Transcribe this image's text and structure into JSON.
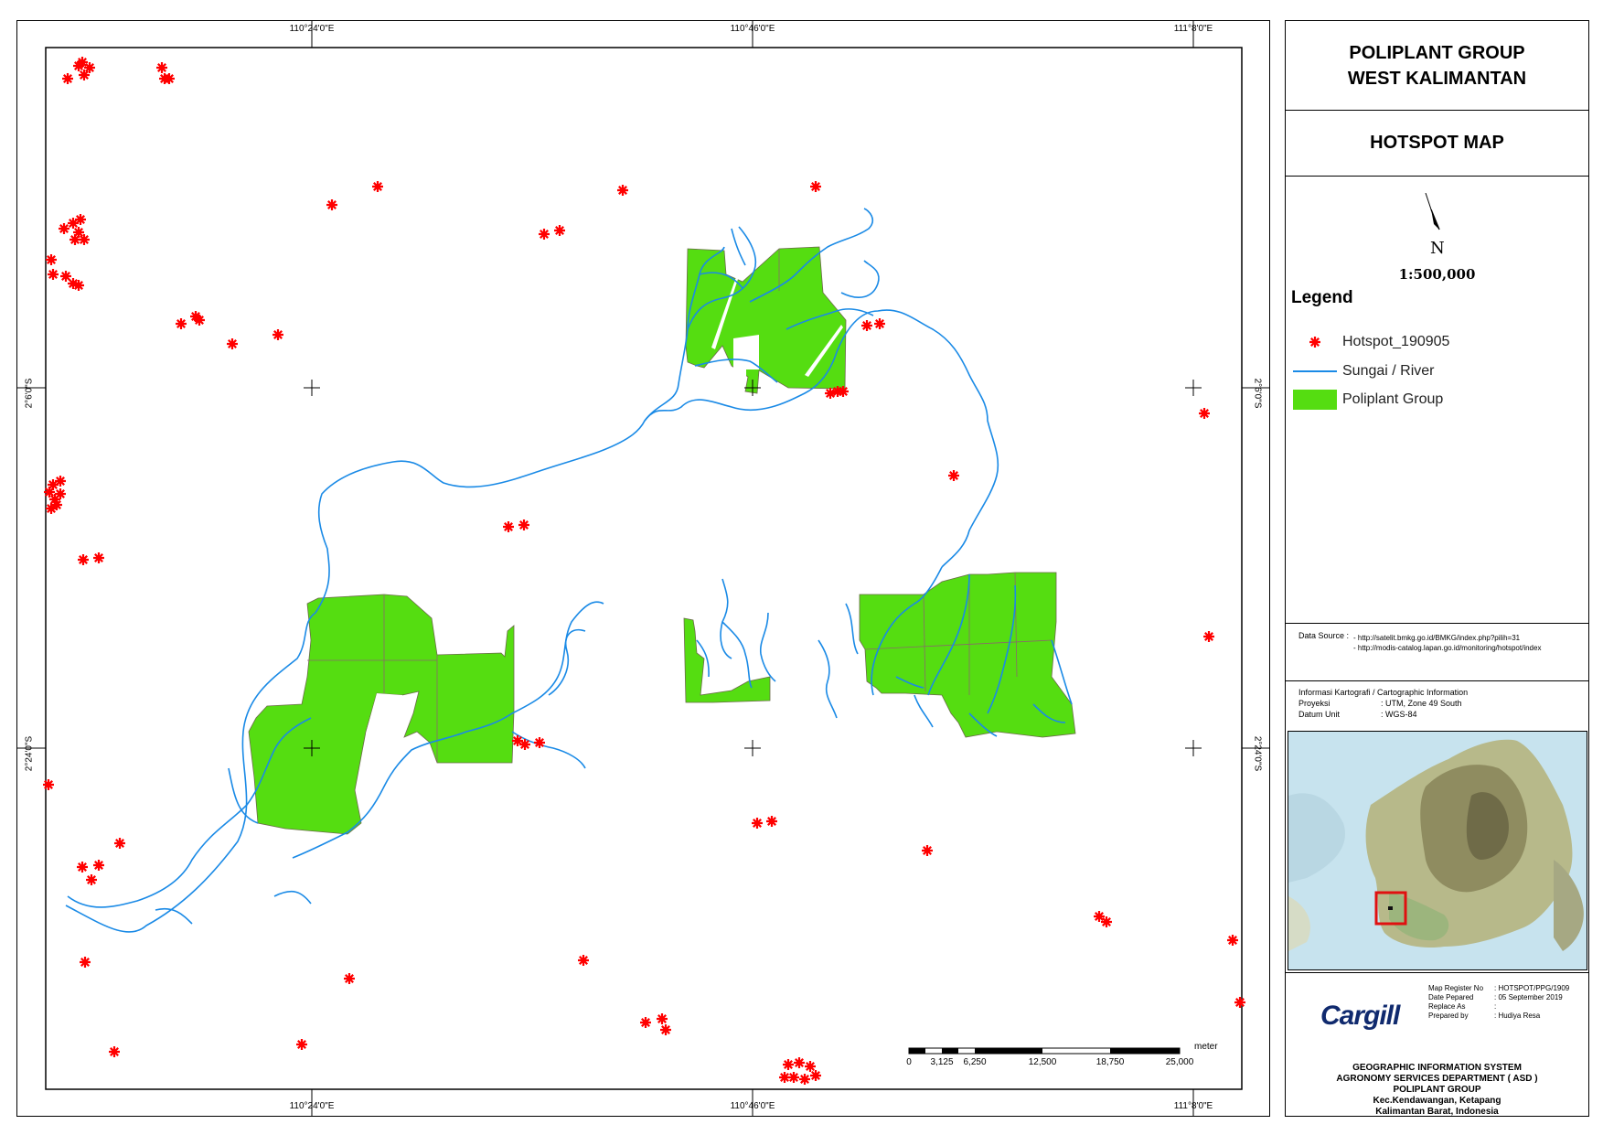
{
  "map": {
    "grid_top": [
      "110°24'0\"E",
      "110°46'0\"E",
      "111°8'0\"E"
    ],
    "grid_bottom": [
      "110°24'0\"E",
      "110°46'0\"E",
      "111°8'0\"E"
    ],
    "grid_left": [
      "2°6'0\"S",
      "2°24'0\"S"
    ],
    "grid_right": [
      "2°6'0\"S",
      "2°24'0\"S"
    ],
    "scale_bar": {
      "unit": "meter",
      "ticks": [
        "0",
        "3,125",
        "6,250",
        "12,500",
        "18,750",
        "25,000"
      ]
    },
    "colors": {
      "hotspot": "#ff0000",
      "river": "#1a8ae6",
      "concession": "#55dd11"
    }
  },
  "title": {
    "line1": "POLIPLANT GROUP",
    "line2": "WEST KALIMANTAN"
  },
  "subtitle": "HOTSPOT MAP",
  "north_arrow": {
    "icon": "north-arrow-icon",
    "label": "N"
  },
  "scale": "1:500,000",
  "legend": {
    "title": "Legend",
    "items": [
      {
        "label": "Hotspot_190905",
        "icon": "asterisk-icon"
      },
      {
        "label": "Sungai / River",
        "icon": "river-line-icon"
      },
      {
        "label": "Poliplant Group",
        "icon": "green-area-icon"
      }
    ]
  },
  "data_source": {
    "label": "Data Source :",
    "lines": [
      "- http://satelit.bmkg.go.id/BMKG/index.php?pilih=31",
      "- http://modis-catalog.lapan.go.id/monitoring/hotspot/index"
    ]
  },
  "cartographic": {
    "title": "Informasi Kartografi / Cartographic Information",
    "rows": [
      {
        "key": "Proyeksi",
        "value": ": UTM, Zone 49 South"
      },
      {
        "key": "Datum Unit",
        "value": ": WGS-84"
      }
    ]
  },
  "footer": {
    "logo_text": "Cargill",
    "meta": [
      {
        "key": "Map Register No",
        "value": ": HOTSPOT/PPG/1909"
      },
      {
        "key": "Date Pepared",
        "value": ": 05 September 2019"
      },
      {
        "key": "Replace As",
        "value": ":"
      },
      {
        "key": "Prepared by",
        "value": ": Hudiya Resa"
      }
    ],
    "lines": [
      "GEOGRAPHIC INFORMATION SYSTEM",
      "AGRONOMY SERVICES DEPARTMENT ( ASD )",
      "POLIPLANT GROUP",
      "Kec.Kendawangan, Ketapang",
      "Kalimantan Barat, Indonesia"
    ]
  }
}
